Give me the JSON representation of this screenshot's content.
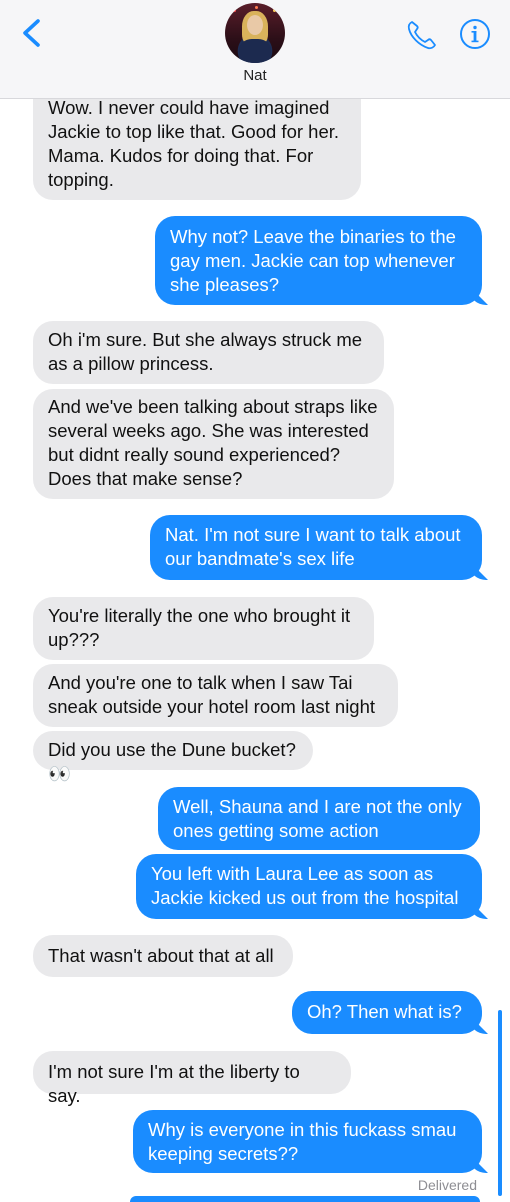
{
  "header": {
    "contact_name": "Nat",
    "back_icon": "chevron-left-icon",
    "call_icon": "phone-icon",
    "details_icon": "info-icon",
    "accent_color": "#1a8cff"
  },
  "messages": [
    {
      "side": "in",
      "text": "Wow. I never could have imagined\nJackie to top like that. Good for her.\nMama. Kudos for doing that. For\ntopping."
    },
    {
      "side": "out",
      "text": "Why not? Leave the binaries to the\ngay men. Jackie can top whenever\nshe pleases?"
    },
    {
      "side": "in",
      "text": "Oh i'm sure. But she always struck me\nas a pillow princess."
    },
    {
      "side": "in",
      "text": "And we've been talking about straps like\nseveral weeks ago. She was interested\nbut didnt really sound experienced?\nDoes that make sense?"
    },
    {
      "side": "out",
      "text": "Nat. I'm not sure I want to talk about\nour bandmate's sex life"
    },
    {
      "side": "in",
      "text": "You're literally the one who brought it\nup???"
    },
    {
      "side": "in",
      "text": "And you're one to talk when I saw Tai\nsneak outside your hotel room last night"
    },
    {
      "side": "in",
      "text": "Did you use the Dune bucket? 👀"
    },
    {
      "side": "out",
      "text": "Well, Shauna and I are not the only\nones getting some action"
    },
    {
      "side": "out",
      "text": "You left with Laura Lee as soon as\nJackie kicked us out from the hospital"
    },
    {
      "side": "in",
      "text": "That wasn't about that at all"
    },
    {
      "side": "out",
      "text": "Oh? Then what is?"
    },
    {
      "side": "in",
      "text": "I'm not sure I'm at the liberty to say."
    },
    {
      "side": "out",
      "text": "Why is everyone in this fuckass smau\nkeeping secrets??"
    }
  ],
  "status": {
    "delivered": "Delivered"
  },
  "colors": {
    "incoming_bubble": "#e9e9eb",
    "outgoing_bubble": "#1a8cff"
  }
}
